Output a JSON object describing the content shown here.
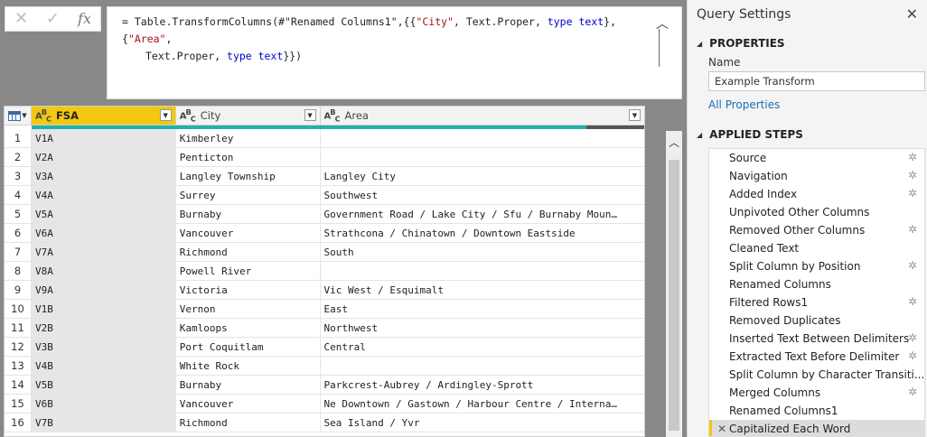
{
  "formula_bar": {
    "cancel_icon": "✕",
    "commit_icon": "✓",
    "fx_label": "fx",
    "parts": {
      "eq": "= Table.TransformColumns(#\"Renamed Columns1\",{{",
      "s1": "\"City\"",
      "m1": ", Text.Proper, ",
      "k1": "type text",
      "m2": "}, {",
      "s2": "\"Area\"",
      "m3": ",",
      "l2a": "Text.Proper, ",
      "k2": "type text",
      "l2b": "}})"
    }
  },
  "grid": {
    "columns": [
      {
        "type": "ABC",
        "name": "FSA"
      },
      {
        "type": "ABC",
        "name": "City"
      },
      {
        "type": "ABC",
        "name": "Area"
      }
    ],
    "rows": [
      {
        "n": "1",
        "fsa": "V1A",
        "city": "Kimberley",
        "area": ""
      },
      {
        "n": "2",
        "fsa": "V2A",
        "city": "Penticton",
        "area": ""
      },
      {
        "n": "3",
        "fsa": "V3A",
        "city": "Langley Township",
        "area": "Langley City"
      },
      {
        "n": "4",
        "fsa": "V4A",
        "city": "Surrey",
        "area": "Southwest"
      },
      {
        "n": "5",
        "fsa": "V5A",
        "city": "Burnaby",
        "area": "Government Road / Lake City / Sfu / Burnaby Moun…"
      },
      {
        "n": "6",
        "fsa": "V6A",
        "city": "Vancouver",
        "area": "Strathcona / Chinatown / Downtown Eastside"
      },
      {
        "n": "7",
        "fsa": "V7A",
        "city": "Richmond",
        "area": "South"
      },
      {
        "n": "8",
        "fsa": "V8A",
        "city": "Powell River",
        "area": ""
      },
      {
        "n": "9",
        "fsa": "V9A",
        "city": "Victoria",
        "area": "Vic West / Esquimalt"
      },
      {
        "n": "10",
        "fsa": "V1B",
        "city": "Vernon",
        "area": "East"
      },
      {
        "n": "11",
        "fsa": "V2B",
        "city": "Kamloops",
        "area": "Northwest"
      },
      {
        "n": "12",
        "fsa": "V3B",
        "city": "Port Coquitlam",
        "area": "Central"
      },
      {
        "n": "13",
        "fsa": "V4B",
        "city": "White Rock",
        "area": ""
      },
      {
        "n": "14",
        "fsa": "V5B",
        "city": "Burnaby",
        "area": "Parkcrest-Aubrey / Ardingley-Sprott"
      },
      {
        "n": "15",
        "fsa": "V6B",
        "city": "Vancouver",
        "area": "Ne Downtown / Gastown / Harbour Centre / Interna…"
      },
      {
        "n": "16",
        "fsa": "V7B",
        "city": "Richmond",
        "area": "Sea Island / Yvr"
      }
    ]
  },
  "panel": {
    "title": "Query Settings",
    "properties_heading": "PROPERTIES",
    "name_label": "Name",
    "name_value": "Example Transform",
    "all_properties": "All Properties",
    "applied_steps_heading": "APPLIED STEPS",
    "steps": [
      {
        "label": "Source",
        "gear": true
      },
      {
        "label": "Navigation",
        "gear": true
      },
      {
        "label": "Added Index",
        "gear": true
      },
      {
        "label": "Unpivoted Other Columns",
        "gear": false
      },
      {
        "label": "Removed Other Columns",
        "gear": true
      },
      {
        "label": "Cleaned Text",
        "gear": false
      },
      {
        "label": "Split Column by Position",
        "gear": true
      },
      {
        "label": "Renamed Columns",
        "gear": false
      },
      {
        "label": "Filtered Rows1",
        "gear": true
      },
      {
        "label": "Removed Duplicates",
        "gear": false
      },
      {
        "label": "Inserted Text Between Delimiters",
        "gear": true
      },
      {
        "label": "Extracted Text Before Delimiter",
        "gear": true
      },
      {
        "label": "Split Column by Character Transiti...",
        "gear": false
      },
      {
        "label": "Merged Columns",
        "gear": true
      },
      {
        "label": "Renamed Columns1",
        "gear": false
      },
      {
        "label": "Capitalized Each Word",
        "gear": false,
        "active": true
      }
    ]
  },
  "colors": {
    "selected_column": "#f2c811",
    "quality_bar": "#20b2aa",
    "link": "#1a6fb3"
  }
}
